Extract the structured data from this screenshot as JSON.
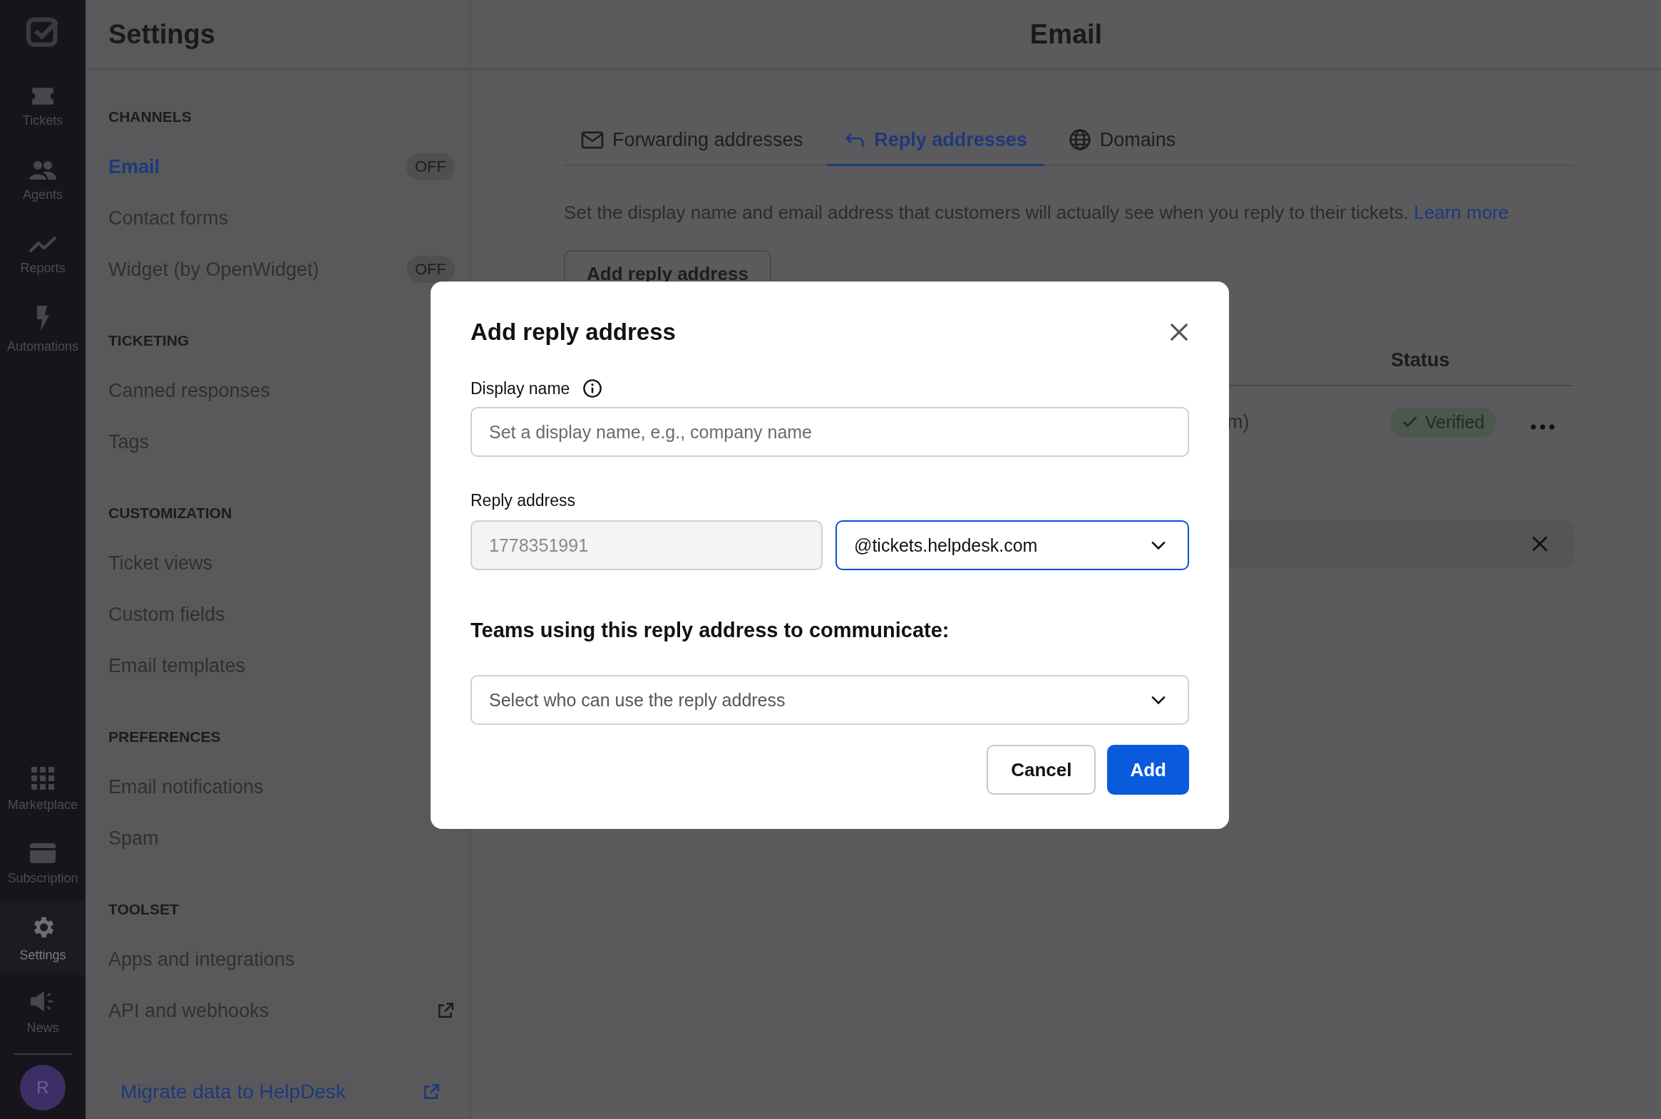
{
  "rail": {
    "top_items": [
      {
        "label": "Tickets",
        "kind": "ticket",
        "selected": false
      },
      {
        "label": "Agents",
        "kind": "people",
        "selected": false
      },
      {
        "label": "Reports",
        "kind": "chart",
        "selected": false
      },
      {
        "label": "Automations",
        "kind": "bolt",
        "selected": false
      }
    ],
    "bottom_items": [
      {
        "label": "Marketplace",
        "kind": "grid",
        "selected": false
      },
      {
        "label": "Subscription",
        "kind": "card",
        "selected": false
      },
      {
        "label": "Settings",
        "kind": "gear",
        "selected": true
      },
      {
        "label": "News",
        "kind": "megaphone",
        "selected": false
      }
    ],
    "avatar": "R"
  },
  "sidebar": {
    "title": "Settings",
    "sections": [
      {
        "heading": "CHANNELS",
        "items": [
          {
            "label": "Email",
            "selected": true,
            "badge": "OFF"
          },
          {
            "label": "Contact forms",
            "selected": false
          },
          {
            "label": "Widget (by OpenWidget)",
            "selected": false,
            "badge": "OFF"
          }
        ]
      },
      {
        "heading": "TICKETING",
        "items": [
          {
            "label": "Canned responses",
            "selected": false
          },
          {
            "label": "Tags",
            "selected": false
          }
        ]
      },
      {
        "heading": "CUSTOMIZATION",
        "items": [
          {
            "label": "Ticket views",
            "selected": false
          },
          {
            "label": "Custom fields",
            "selected": false
          },
          {
            "label": "Email templates",
            "selected": false
          }
        ]
      },
      {
        "heading": "PREFERENCES",
        "items": [
          {
            "label": "Email notifications",
            "selected": false
          },
          {
            "label": "Spam",
            "selected": false
          }
        ]
      },
      {
        "heading": "TOOLSET",
        "items": [
          {
            "label": "Apps and integrations",
            "selected": false
          },
          {
            "label": "API and webhooks",
            "selected": false,
            "external": true
          }
        ]
      }
    ],
    "migrate_link": "Migrate data to HelpDesk"
  },
  "main": {
    "title": "Email",
    "tabs": [
      {
        "label": "Forwarding addresses",
        "kind": "envelope",
        "selected": false
      },
      {
        "label": "Reply addresses",
        "kind": "reply",
        "selected": true
      },
      {
        "label": "Domains",
        "kind": "globe",
        "selected": false
      }
    ],
    "description": "Set the display name and email address that customers will actually see when you reply to their tickets.",
    "learn_more": "Learn more",
    "add_button": "Add reply address",
    "table": {
      "status_column": "Status",
      "rows": [
        {
          "address": "m)",
          "status": "Verified"
        }
      ]
    }
  },
  "modal": {
    "title": "Add reply address",
    "display_name": {
      "label": "Display name",
      "placeholder": "Set a display name, e.g., company name"
    },
    "reply_address": {
      "label": "Reply address",
      "local_part": "1778351991",
      "domain": "@tickets.helpdesk.com"
    },
    "teams": {
      "heading": "Teams using this reply address to communicate:",
      "placeholder": "Select who can use the reply address"
    },
    "buttons": [
      {
        "label": "Cancel",
        "kind": "secondary"
      },
      {
        "label": "Add",
        "kind": "primary"
      }
    ]
  }
}
